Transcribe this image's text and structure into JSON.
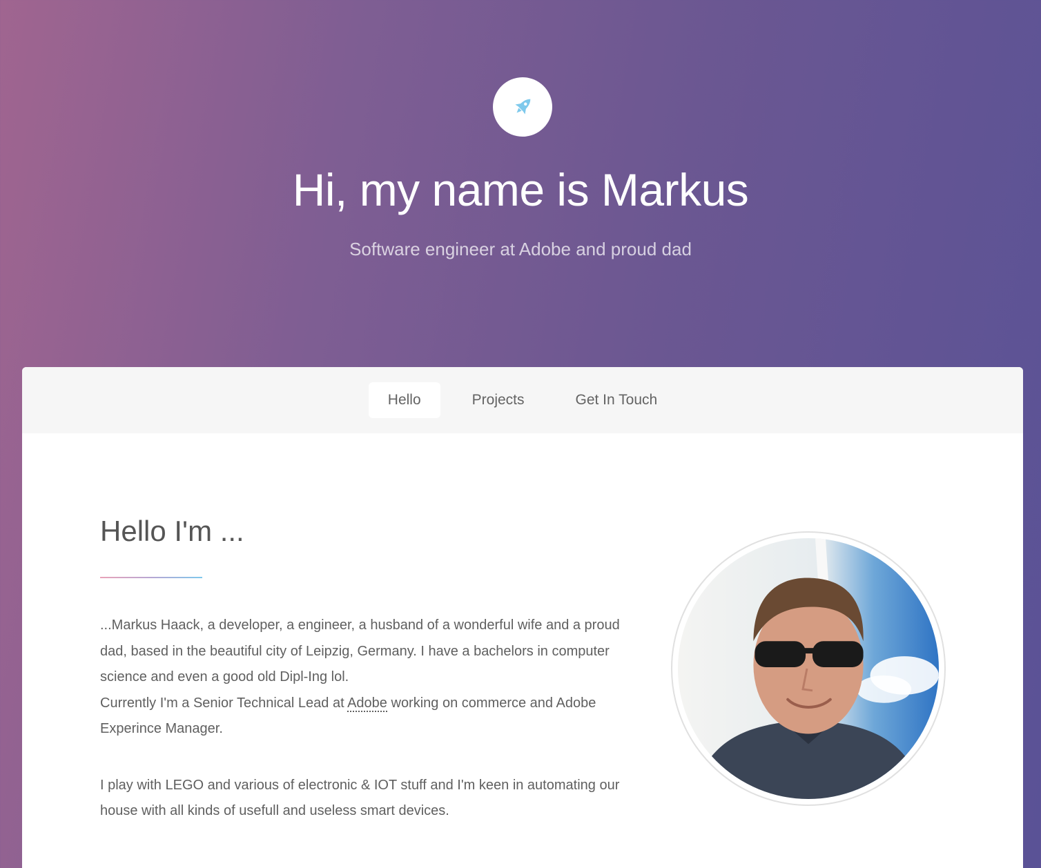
{
  "header": {
    "logo_icon": "rocket-icon",
    "title": "Hi, my name is Markus",
    "subtitle": "Software engineer at Adobe and proud dad"
  },
  "nav": {
    "items": [
      {
        "label": "Hello",
        "active": true
      },
      {
        "label": "Projects",
        "active": false
      },
      {
        "label": "Get In Touch",
        "active": false
      }
    ]
  },
  "intro": {
    "heading": "Hello I'm ...",
    "para1_a": "...Markus Haack, a developer, a engineer, a husband of a wonderful wife and a proud dad, based in the beautiful city of Leipzig, Germany. I have a bachelors in computer science and even a good old Dipl-Ing lol.",
    "para1_b": "Currently I'm a Senior Technical Lead at ",
    "adobe_link": "Adobe",
    "para1_c": " working on commerce and Adobe Experince Manager.",
    "para2": "I play with LEGO and various of electronic & IOT stuff and I'm keen in automating our house with all kinds of usefull and useless smart devices."
  },
  "colors": {
    "accent_icon": "#7ec9ec",
    "gradient_start": "#a06590",
    "gradient_end": "#5a5296"
  }
}
